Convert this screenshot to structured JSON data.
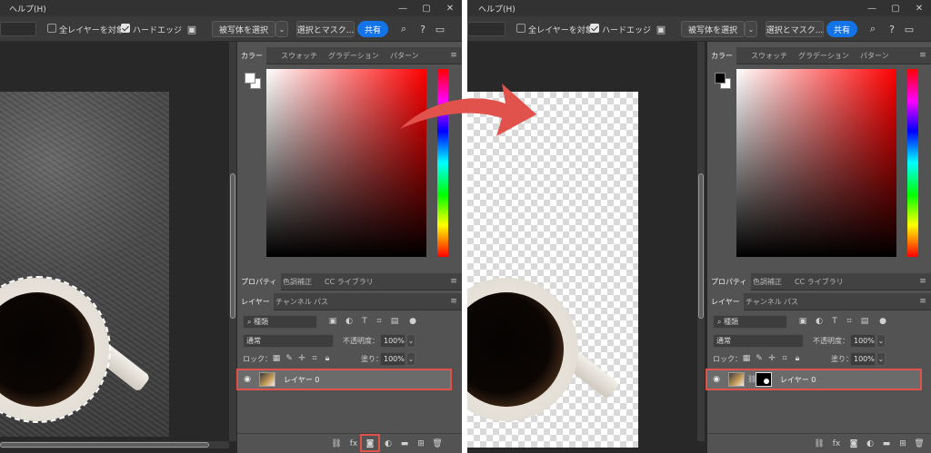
{
  "menu": {
    "help": "ヘルプ(H)"
  },
  "options": {
    "all_layers": "全レイヤーを対象",
    "hard_edge": "ハードエッジ",
    "select_subject": "被写体を選択",
    "select_mask": "選択とマスク...",
    "share": "共有"
  },
  "color_panel": {
    "tabs": [
      "カラー",
      "スウォッチ",
      "グラデーション",
      "パターン"
    ]
  },
  "props_panel": {
    "tabs": [
      "プロパティ",
      "色調補正",
      "CC ライブラリ"
    ]
  },
  "layers_panel": {
    "tabs": [
      "レイヤー",
      "チャンネル",
      "パス"
    ],
    "filter": "種類",
    "blend_mode": "通常",
    "opacity_label": "不透明度：",
    "opacity_value": "100%",
    "lock_label": "ロック：",
    "fill_label": "塗り：",
    "fill_value": "100%",
    "layer_name": "レイヤー 0"
  },
  "bottom_icons": [
    "link-icon",
    "fx-icon",
    "add-mask-icon",
    "adjustment-icon",
    "folder-icon",
    "new-layer-icon",
    "trash-icon"
  ],
  "highlight_color": "#e0524b",
  "arrow_color": "#e0524b",
  "share_color": "#1473e6"
}
